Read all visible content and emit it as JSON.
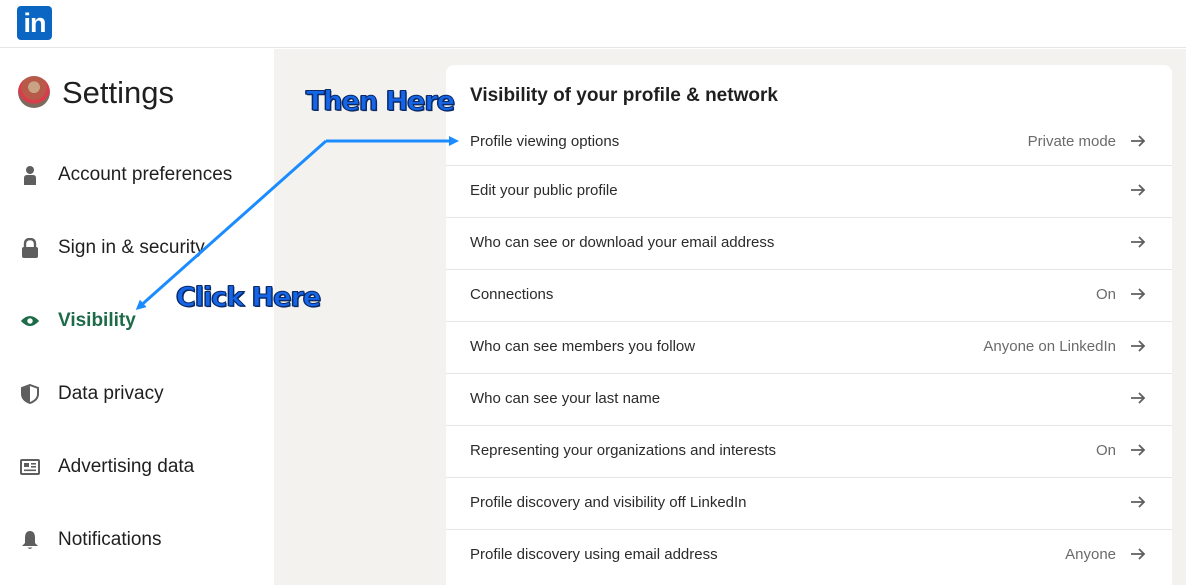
{
  "header": {
    "logo_text": "in"
  },
  "sidebar": {
    "title": "Settings",
    "items": [
      {
        "label": "Account preferences",
        "icon": "person-icon",
        "active": false
      },
      {
        "label": "Sign in & security",
        "icon": "lock-icon",
        "active": false
      },
      {
        "label": "Visibility",
        "icon": "eye-icon",
        "active": true
      },
      {
        "label": "Data privacy",
        "icon": "shield-icon",
        "active": false
      },
      {
        "label": "Advertising data",
        "icon": "newspaper-icon",
        "active": false
      },
      {
        "label": "Notifications",
        "icon": "bell-icon",
        "active": false
      }
    ]
  },
  "main": {
    "section_title": "Visibility of your profile & network",
    "rows": [
      {
        "label": "Profile viewing options",
        "value": "Private mode"
      },
      {
        "label": "Edit your public profile",
        "value": ""
      },
      {
        "label": "Who can see or download your email address",
        "value": ""
      },
      {
        "label": "Connections",
        "value": "On"
      },
      {
        "label": "Who can see members you follow",
        "value": "Anyone on LinkedIn"
      },
      {
        "label": "Who can see your last name",
        "value": ""
      },
      {
        "label": "Representing your organizations and interests",
        "value": "On"
      },
      {
        "label": "Profile discovery and visibility off LinkedIn",
        "value": ""
      },
      {
        "label": "Profile discovery using email address",
        "value": "Anyone"
      }
    ]
  },
  "annotations": {
    "then_here": "Then Here",
    "click_here": "Click Here"
  },
  "colors": {
    "brand": "#0a66c2",
    "active_nav": "#1e6b4a",
    "main_bg": "#f4f2ee",
    "annotation_arrow": "#1a8cff"
  }
}
